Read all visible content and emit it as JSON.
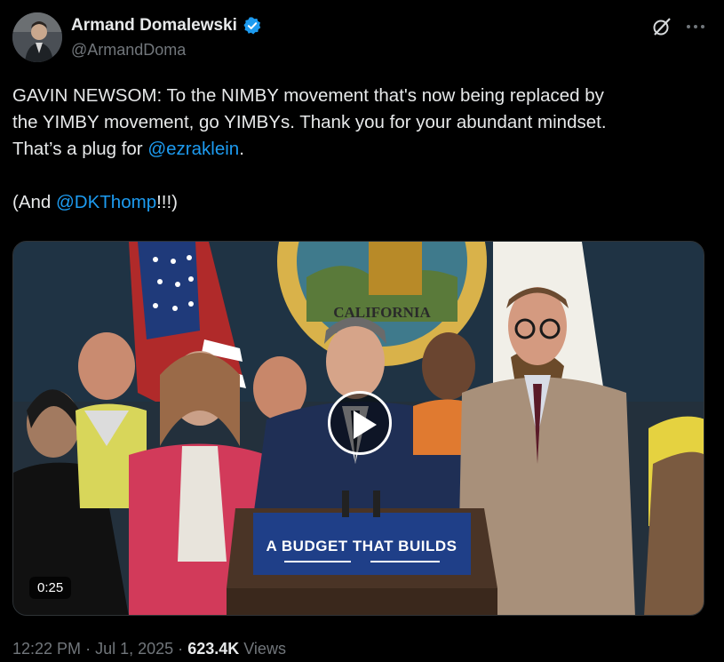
{
  "author": {
    "display_name": "Armand Domalewski",
    "handle": "@ArmandDoma",
    "verified_icon": "verified-badge-icon",
    "accent_color": "#1d9bf0"
  },
  "tweet": {
    "line1": "GAVIN NEWSOM: To the NIMBY movement that's now being replaced by",
    "line2": "the YIMBY movement, go YIMBYs. Thank you for your abundant mindset.",
    "line3_prefix": "That’s a plug for ",
    "line3_mention": "@ezraklein",
    "line3_suffix": ".",
    "line4_prefix": "(And ",
    "line4_mention": "@DKThomp",
    "line4_suffix": "!!!)"
  },
  "media": {
    "duration": "0:25",
    "podium_text": "A BUDGET THAT BUILDS",
    "seal_text": "CALIFORNIA"
  },
  "meta": {
    "time": "12:22 PM",
    "separator": "·",
    "date": "Jul 1, 2025",
    "views_count": "623.4K",
    "views_label": "Views"
  },
  "icons": {
    "grok": "grok-icon",
    "more": "more-icon",
    "play": "play-icon"
  }
}
